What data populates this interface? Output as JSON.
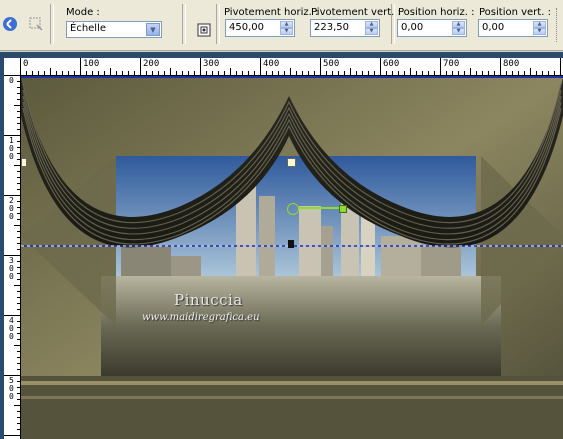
{
  "toolbar": {
    "mode_label": "Mode :",
    "mode_value": "Échelle",
    "pivot_h_label": "Pivotement horiz. :",
    "pivot_h_value": "450,00",
    "pivot_v_label": "Pivotement vert. :",
    "pivot_v_value": "223,50",
    "pos_h_label": "Position horiz. :",
    "pos_h_value": "0,00",
    "pos_v_label": "Position vert. :",
    "pos_v_value": "0,00"
  },
  "ruler_top": [
    "0",
    "100",
    "200",
    "300",
    "400",
    "500",
    "600",
    "700",
    "800"
  ],
  "ruler_left": [
    "0",
    "100",
    "200",
    "300",
    "400",
    "500"
  ],
  "watermark": {
    "name": "Pinuccia",
    "url": "www.maidiregrafica.eu"
  },
  "colors": {
    "toolbar_bg": "#ece9d8",
    "canvas_bg": "#2c4a6b",
    "handle_green": "#8edc2b",
    "guide_blue": "#1f2fa8"
  }
}
